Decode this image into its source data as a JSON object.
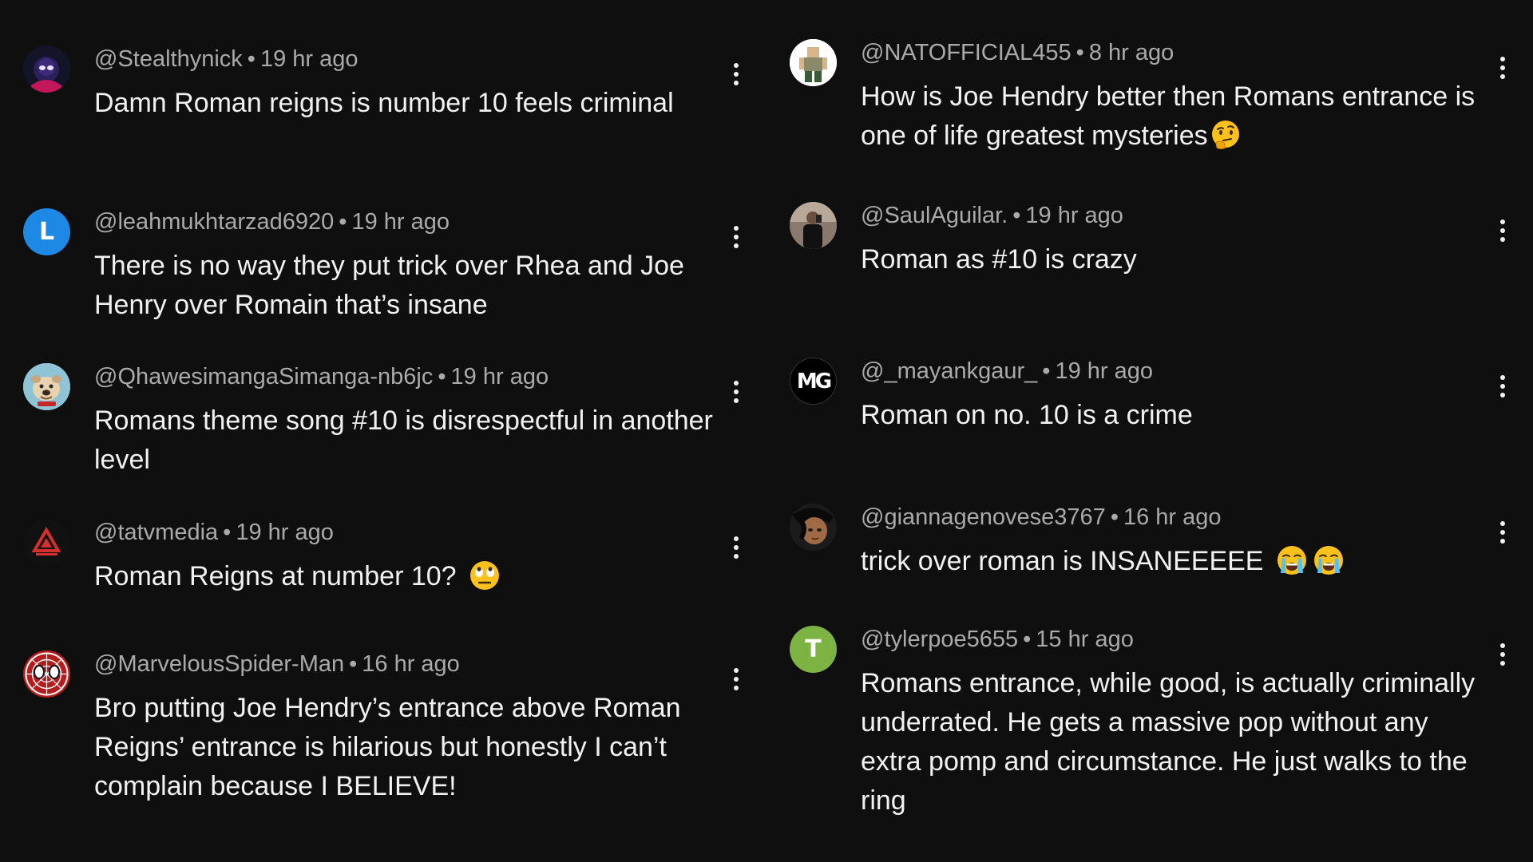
{
  "comments_left": [
    {
      "handle": "@Stealthynick",
      "time": "19 hr ago",
      "text": "Damn Roman reigns is number 10 feels criminal",
      "avatar": "spider-verse-avatar",
      "emoji": ""
    },
    {
      "handle": "@leahmukhtarzad6920",
      "time": "19 hr ago",
      "text": "There is no way they put trick over Rhea and Joe Henry over Romain that’s insane",
      "avatar_letter": "L",
      "avatar_color": "#1e88e5",
      "emoji": ""
    },
    {
      "handle": "@QhawesimangaSimanga-nb6jc",
      "time": "19 hr ago",
      "text": "Romans theme song #10 is disrespectful in another level",
      "avatar": "bulldog-avatar",
      "emoji": ""
    },
    {
      "handle": "@tatvmedia",
      "time": "19 hr ago",
      "text": "Roman Reigns at number 10?",
      "avatar": "tatv-logo-avatar",
      "emoji": "eye-roll-emoji"
    },
    {
      "handle": "@MarvelousSpider-Man",
      "time": "16 hr ago",
      "text": "Bro putting Joe Hendry’s entrance above Roman Reigns’ entrance is hilarious but honestly I can’t complain because I BELIEVE!",
      "avatar": "spider-man-avatar",
      "emoji": ""
    }
  ],
  "comments_right": [
    {
      "handle": "@NATOFFICIAL455",
      "time": "8 hr ago",
      "text": "How is Joe Hendry better then Romans entrance is one of life greatest mysteries",
      "avatar": "roblox-avatar",
      "emoji": "thinking-emoji"
    },
    {
      "handle": "@SaulAguilar.",
      "time": "19 hr ago",
      "text": "Roman as #10 is crazy",
      "avatar": "photo-avatar",
      "emoji": ""
    },
    {
      "handle": "@_mayankgaur_",
      "time": "19 hr ago",
      "text": "Roman on no. 10 is a crime",
      "avatar_letter": "MG",
      "avatar_color": "#000000",
      "emoji": ""
    },
    {
      "handle": "@giannagenovese3767",
      "time": "16 hr ago",
      "text": "trick over roman is INSANEEEEE",
      "avatar": "anime-avatar",
      "emoji": "crying-emoji"
    },
    {
      "handle": "@tylerpoe5655",
      "time": "15 hr ago",
      "text": "Romans entrance, while good, is actually criminally underrated. He gets a massive pop without any extra pomp and circumstance. He just walks to the ring",
      "avatar_letter": "T",
      "avatar_color": "#7cb342",
      "emoji": ""
    }
  ],
  "separator": "•",
  "colors": {
    "background": "#0f0f0f",
    "meta": "#aaaaaa",
    "text": "#f1f1f1"
  }
}
